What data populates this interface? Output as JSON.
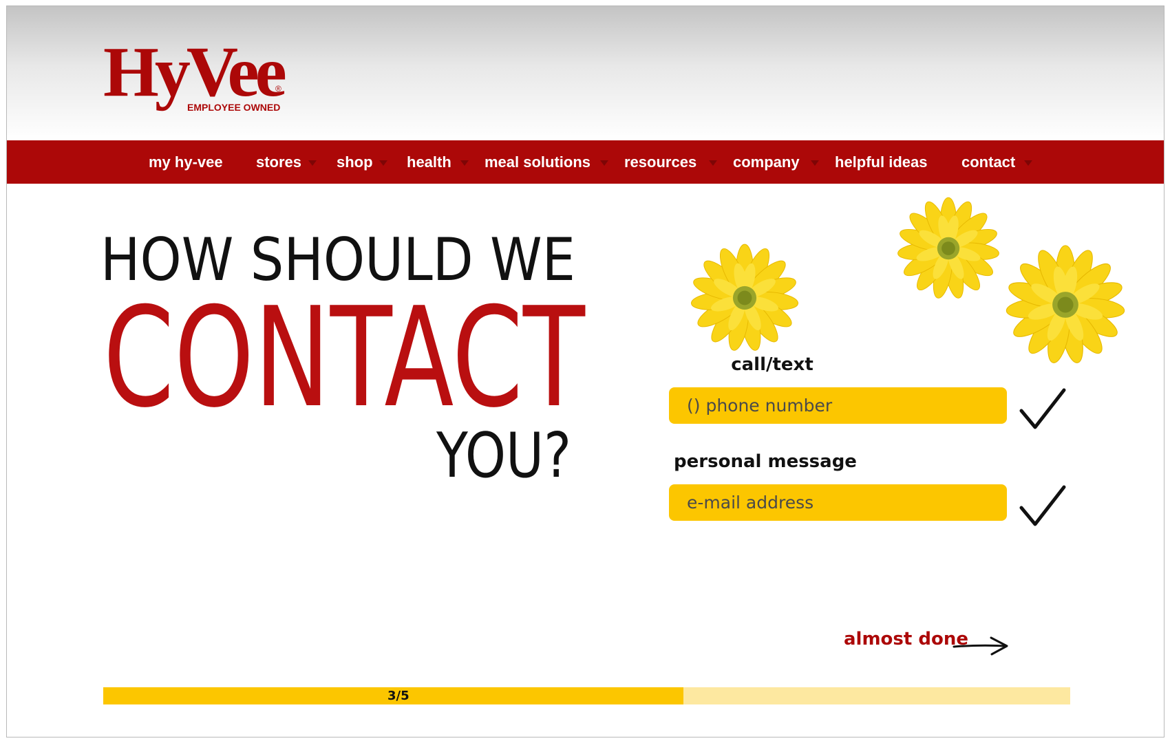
{
  "brand": {
    "logo_text": "HyVee",
    "tagline": "EMPLOYEE OWNED",
    "registered_mark": "®",
    "color": "#ac0808"
  },
  "nav": {
    "items": [
      {
        "label": "my hy-vee",
        "has_dropdown": false
      },
      {
        "label": "stores",
        "has_dropdown": true
      },
      {
        "label": "shop",
        "has_dropdown": true
      },
      {
        "label": "health",
        "has_dropdown": true
      },
      {
        "label": "meal solutions",
        "has_dropdown": true
      },
      {
        "label": "resources",
        "has_dropdown": true
      },
      {
        "label": "company",
        "has_dropdown": true
      },
      {
        "label": "helpful ideas",
        "has_dropdown": false
      },
      {
        "label": "contact",
        "has_dropdown": true
      }
    ],
    "background": "#ac0808"
  },
  "headline": {
    "line1": "HOW SHOULD WE",
    "line2": "CONTACT",
    "line3": "YOU?",
    "accent_color": "#b90f10"
  },
  "form": {
    "call_label": "call/text",
    "phone_placeholder": "() phone number",
    "message_label": "personal message",
    "email_placeholder": "e-mail address",
    "field_color": "#fcc600",
    "phone_checked": true,
    "email_checked": true
  },
  "next": {
    "label": "almost done",
    "icon": "arrow-right-icon"
  },
  "progress": {
    "label": "3/5",
    "step": 3,
    "total": 5,
    "fraction": 0.6,
    "fill_color": "#fcc600",
    "track_color": "#fde8a0"
  },
  "decor": {
    "flowers": "yellow-daisy-icon"
  }
}
